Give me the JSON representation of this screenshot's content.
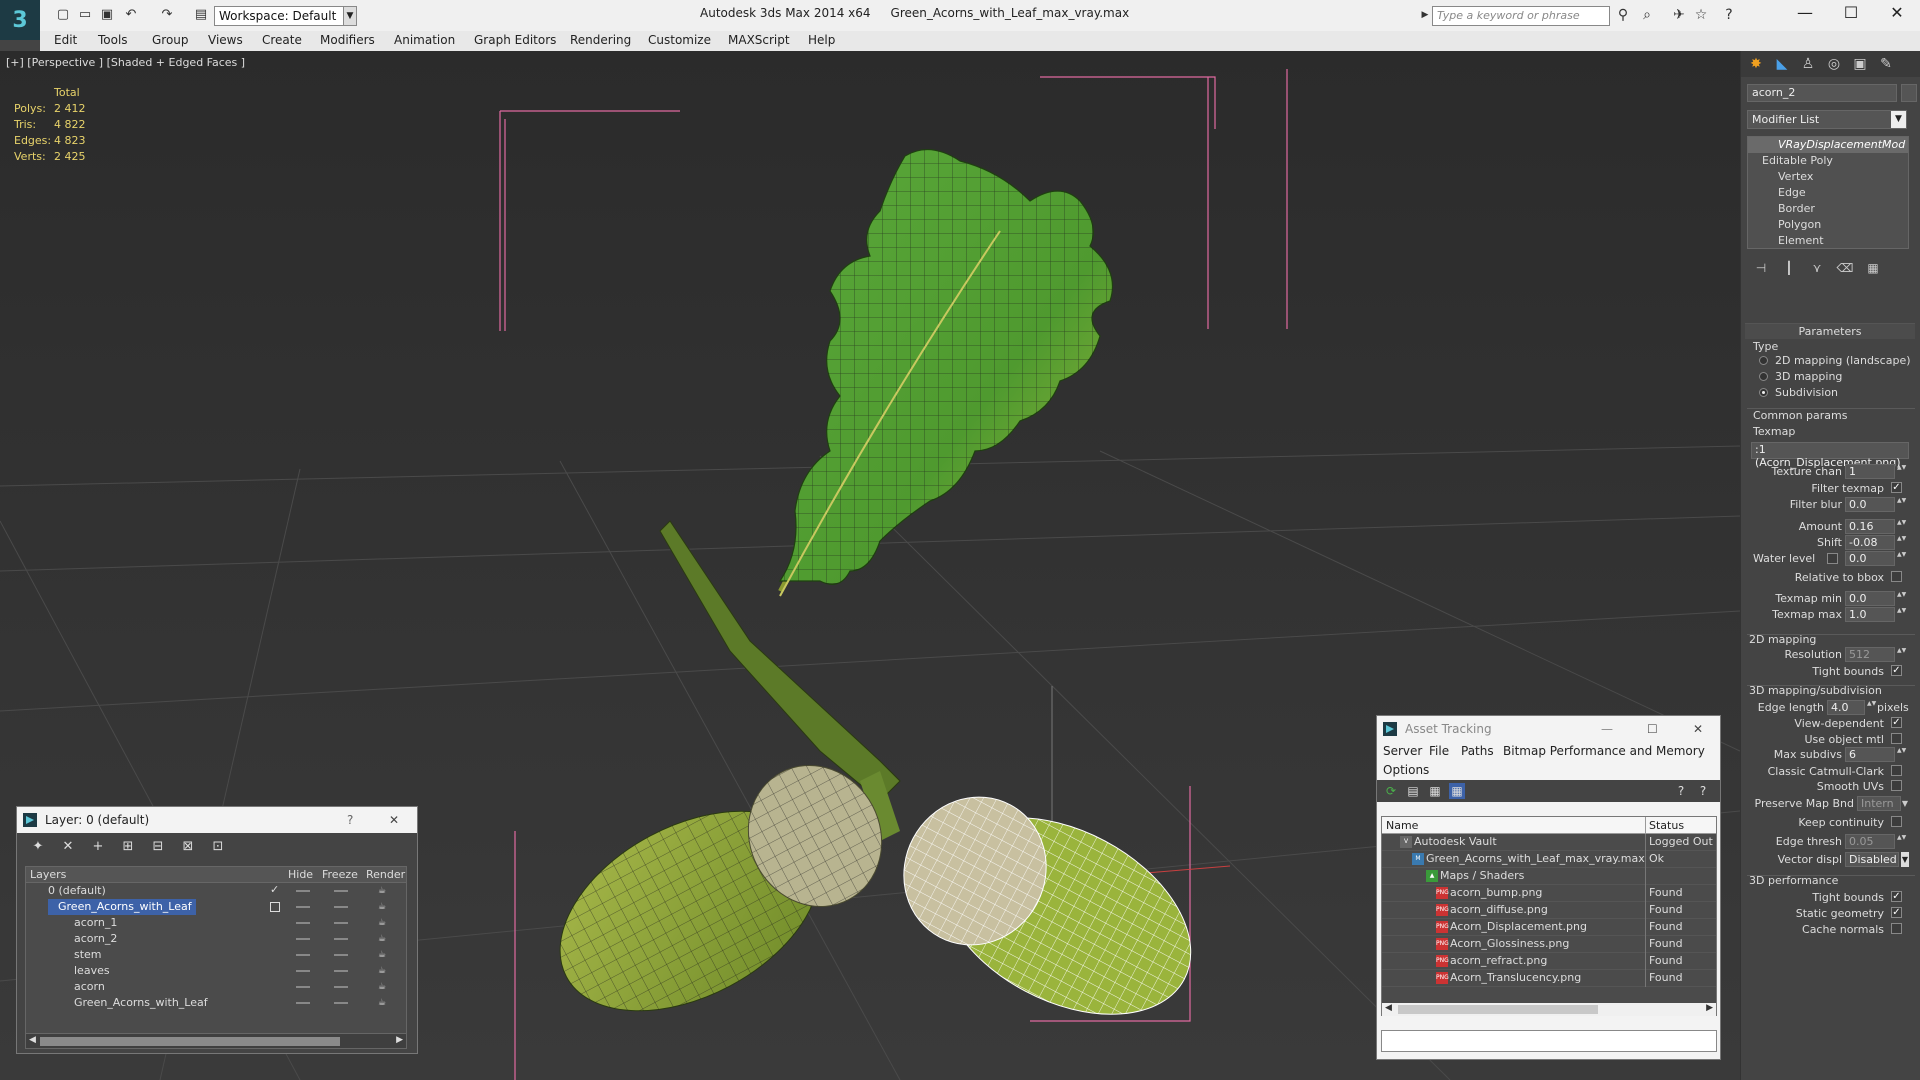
{
  "titlebar": {
    "workspace": "Workspace: Default",
    "app": "Autodesk 3ds Max  2014 x64",
    "file": "Green_Acorns_with_Leaf_max_vray.max",
    "search_placeholder": "Type a keyword or phrase"
  },
  "menu": [
    "Edit",
    "Tools",
    "Group",
    "Views",
    "Create",
    "Modifiers",
    "Animation",
    "Graph Editors",
    "Rendering",
    "Customize",
    "MAXScript",
    "Help"
  ],
  "viewport": {
    "label": "[+] [Perspective ] [Shaded + Edged Faces ]",
    "stats": {
      "header": "Total",
      "rows": [
        {
          "k": "Polys:",
          "v": "2 412"
        },
        {
          "k": "Tris:",
          "v": "4 822"
        },
        {
          "k": "Edges:",
          "v": "4 823"
        },
        {
          "k": "Verts:",
          "v": "2 425"
        }
      ]
    }
  },
  "command_panel": {
    "object_name": "acorn_2",
    "modifier_list": "Modifier List",
    "stack": [
      "VRayDisplacementMod",
      "Editable Poly",
      "Vertex",
      "Edge",
      "Border",
      "Polygon",
      "Element"
    ],
    "parameters_title": "Parameters",
    "type_label": "Type",
    "type_options": [
      "2D mapping (landscape)",
      "3D mapping",
      "Subdivision"
    ],
    "common_params": "Common params",
    "texmap_label": "Texmap",
    "texmap_value": ":1 (Acorn_Displacement.png)",
    "texture_chan_label": "Texture chan",
    "texture_chan_value": "1",
    "filter_texmap_label": "Filter texmap",
    "filter_blur_label": "Filter blur",
    "filter_blur_value": "0.0",
    "amount_label": "Amount",
    "amount_value": "0.16",
    "shift_label": "Shift",
    "shift_value": "-0.08",
    "water_level_label": "Water level",
    "water_level_value": "0.0",
    "relative_bbox_label": "Relative to bbox",
    "texmap_min_label": "Texmap min",
    "texmap_min_value": "0.0",
    "texmap_max_label": "Texmap max",
    "texmap_max_value": "1.0",
    "mapping2d_title": "2D mapping",
    "resolution_label": "Resolution",
    "resolution_value": "512",
    "tight_bounds_label": "Tight bounds",
    "mapping3d_title": "3D mapping/subdivision",
    "edge_length_label": "Edge length",
    "edge_length_value": "4.0",
    "pixels_label": "pixels",
    "view_dependent_label": "View-dependent",
    "use_object_mtl_label": "Use object mtl",
    "max_subdivs_label": "Max subdivs",
    "max_subdivs_value": "6",
    "classic_catmull_label": "Classic Catmull-Clark",
    "smooth_uvs_label": "Smooth UVs",
    "preserve_map_label": "Preserve Map Bnd",
    "preserve_map_value": "Intern",
    "keep_continuity_label": "Keep continuity",
    "edge_thresh_label": "Edge thresh",
    "edge_thresh_value": "0.05",
    "vector_displ_label": "Vector displ",
    "vector_displ_value": "Disabled",
    "perf3d_title": "3D performance",
    "tight_bounds2_label": "Tight bounds",
    "static_geometry_label": "Static geometry",
    "cache_normals_label": "Cache normals"
  },
  "layer_window": {
    "title": "Layer: 0 (default)",
    "help": "?",
    "columns": {
      "layers": "Layers",
      "hide": "Hide",
      "freeze": "Freeze",
      "render": "Render"
    },
    "rows": [
      {
        "name": "0 (default)"
      },
      {
        "name": "Green_Acorns_with_Leaf"
      },
      {
        "name": "acorn_1"
      },
      {
        "name": "acorn_2"
      },
      {
        "name": "stem"
      },
      {
        "name": "leaves"
      },
      {
        "name": "acorn"
      },
      {
        "name": "Green_Acorns_with_Leaf"
      }
    ]
  },
  "asset_window": {
    "title": "Asset Tracking",
    "menu": [
      "Server",
      "File",
      "Paths",
      "Bitmap Performance and Memory",
      "Options"
    ],
    "columns": {
      "name": "Name",
      "status": "Status"
    },
    "rows": [
      {
        "name": "Autodesk Vault",
        "status": "Logged Out"
      },
      {
        "name": "Green_Acorns_with_Leaf_max_vray.max",
        "status": "Ok"
      },
      {
        "name": "Maps / Shaders",
        "status": ""
      },
      {
        "name": "acorn_bump.png",
        "status": "Found"
      },
      {
        "name": "acorn_diffuse.png",
        "status": "Found"
      },
      {
        "name": "Acorn_Displacement.png",
        "status": "Found"
      },
      {
        "name": "Acorn_Glossiness.png",
        "status": "Found"
      },
      {
        "name": "acorn_refract.png",
        "status": "Found"
      },
      {
        "name": "Acorn_Translucency.png",
        "status": "Found"
      }
    ]
  }
}
